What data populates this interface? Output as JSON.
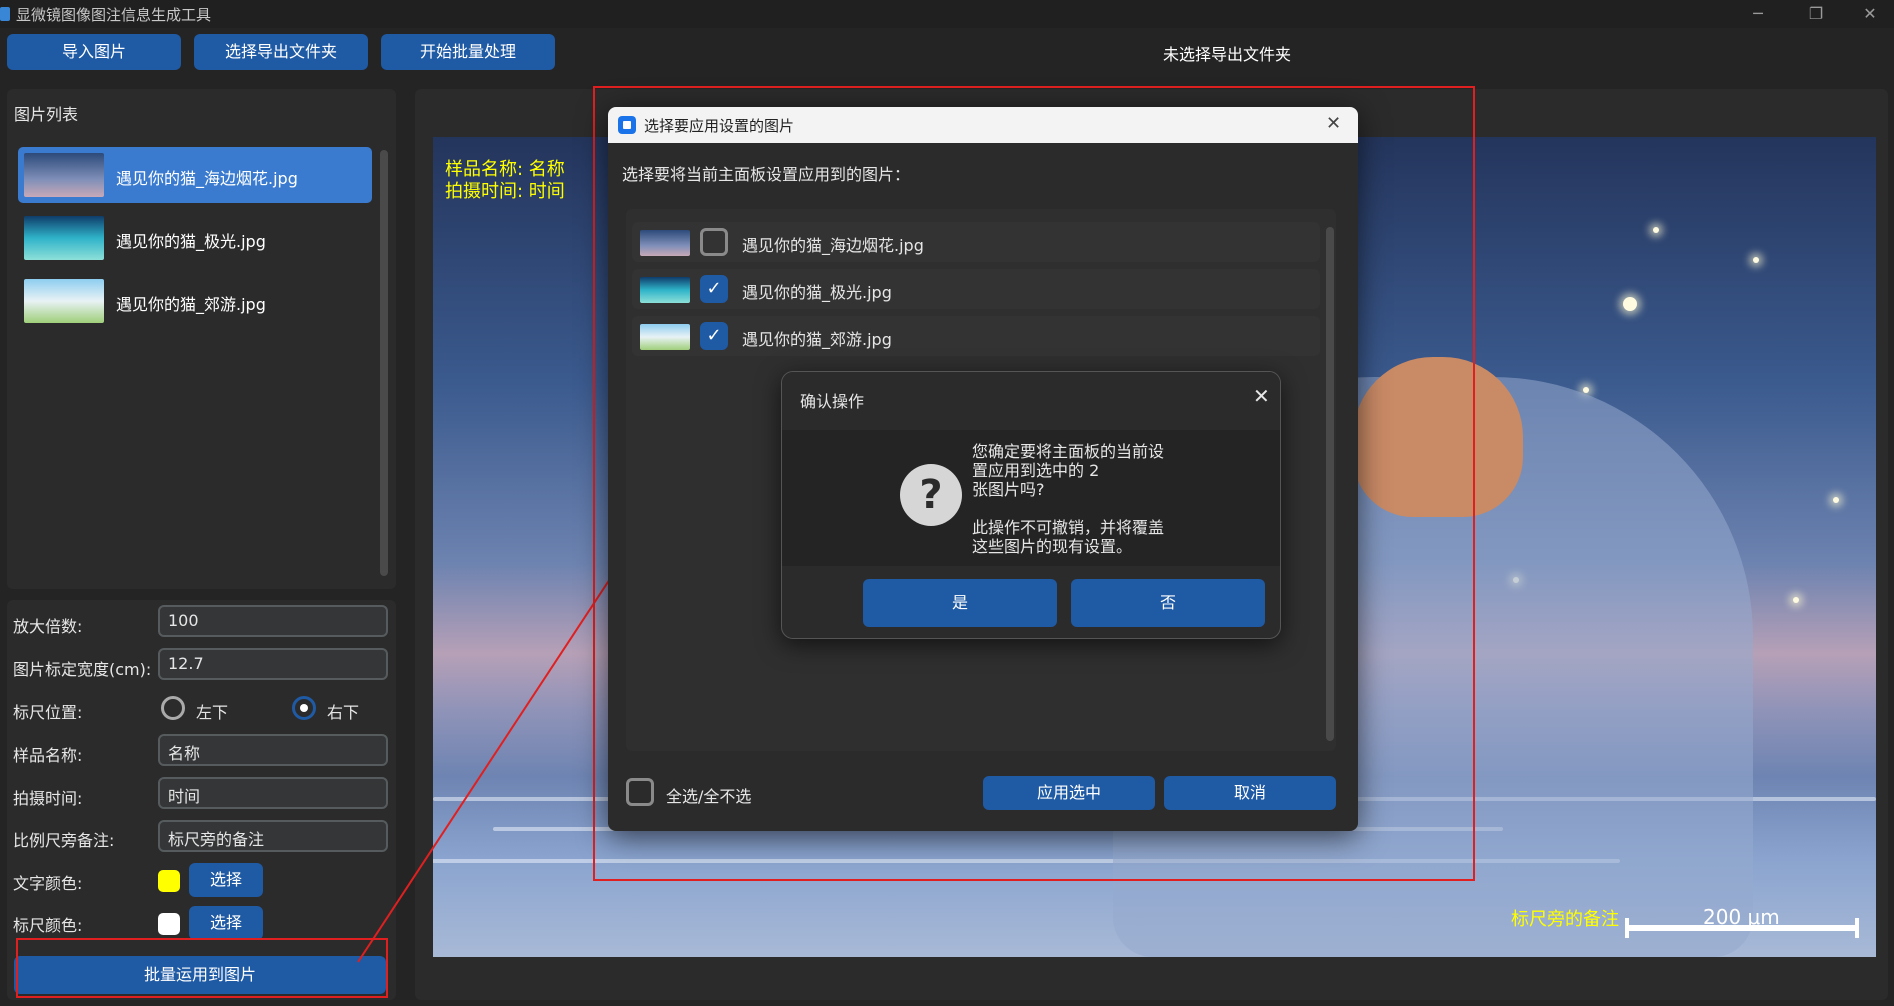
{
  "app": {
    "title": "显微镜图像图注信息生成工具"
  },
  "window_controls": {
    "minimize": "─",
    "maximize": "❐",
    "close": "✕"
  },
  "toolbar": {
    "import_label": "导入图片",
    "choose_export_label": "选择导出文件夹",
    "start_batch_label": "开始批量处理",
    "export_status": "未选择导出文件夹"
  },
  "image_list": {
    "title": "图片列表",
    "items": [
      {
        "label": "遇见你的猫_海边烟花.jpg",
        "selected": true
      },
      {
        "label": "遇见你的猫_极光.jpg",
        "selected": false
      },
      {
        "label": "遇见你的猫_郊游.jpg",
        "selected": false
      }
    ]
  },
  "form": {
    "magnification_label": "放大倍数:",
    "magnification_value": "100",
    "width_label": "图片标定宽度(cm):",
    "width_value": "12.7",
    "position_label": "标尺位置:",
    "position_options": [
      "左下",
      "右下"
    ],
    "position_selected": "右下",
    "sample_label": "样品名称:",
    "sample_value": "名称",
    "time_label": "拍摄时间:",
    "time_value": "时间",
    "note_label": "比例尺旁备注:",
    "note_value": "标尺旁的备注",
    "text_color_label": "文字颜色:",
    "text_color": "#ffff00",
    "scale_color_label": "标尺颜色:",
    "scale_color": "#ffffff",
    "pick_label": "选择",
    "batch_button": "批量运用到图片"
  },
  "preview": {
    "sample_text": "样品名称: 名称",
    "time_text": "拍摄时间: 时间",
    "scale_note": "标尺旁的备注",
    "scale_label": "200 μm"
  },
  "dialog_select": {
    "title": "选择要应用设置的图片",
    "close": "✕",
    "prompt": "选择要将当前主面板设置应用到的图片：",
    "items": [
      {
        "label": "遇见你的猫_海边烟花.jpg",
        "checked": false
      },
      {
        "label": "遇见你的猫_极光.jpg",
        "checked": true
      },
      {
        "label": "遇见你的猫_郊游.jpg",
        "checked": true
      }
    ],
    "select_all": "全选/全不选",
    "apply_button": "应用选中",
    "cancel_button": "取消"
  },
  "dialog_confirm": {
    "title": "确认操作",
    "close": "✕",
    "icon": "question-icon",
    "message_lines": [
      "您确定要将主面板的当前设",
      "置应用到选中的 2",
      "张图片吗?",
      "此操作不可撤销，并将覆盖",
      "这些图片的现有设置。"
    ],
    "yes_button": "是",
    "no_button": "否"
  },
  "colors": {
    "accent": "#1f5aa5",
    "selected_item": "#3a7bd0",
    "annotation_red": "#e02020"
  }
}
